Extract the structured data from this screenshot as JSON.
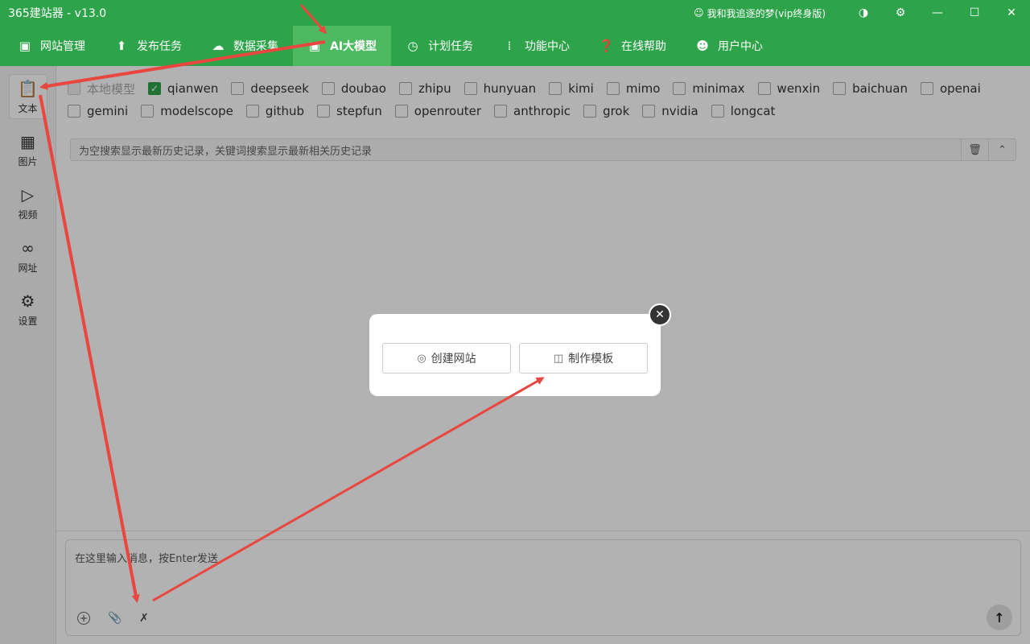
{
  "app": {
    "title": "365建站器 - v13.0",
    "user": "我和我追逐的梦(vip终身版)"
  },
  "menu": [
    {
      "label": "网站管理",
      "icon": "window-icon"
    },
    {
      "label": "发布任务",
      "icon": "upload-icon"
    },
    {
      "label": "数据采集",
      "icon": "cloud-download-icon"
    },
    {
      "label": "AI大模型",
      "icon": "robot-icon",
      "active": true
    },
    {
      "label": "计划任务",
      "icon": "clock-icon"
    },
    {
      "label": "功能中心",
      "icon": "grid-icon"
    },
    {
      "label": "在线帮助",
      "icon": "help-icon"
    },
    {
      "label": "用户中心",
      "icon": "user-icon"
    }
  ],
  "sidebar": [
    {
      "label": "文本",
      "icon": "clipboard-icon",
      "active": true
    },
    {
      "label": "图片",
      "icon": "image-icon"
    },
    {
      "label": "视频",
      "icon": "video-icon"
    },
    {
      "label": "网址",
      "icon": "link-icon"
    },
    {
      "label": "设置",
      "icon": "gear-icon"
    }
  ],
  "models": [
    {
      "label": "本地模型",
      "checked": false,
      "disabled": true
    },
    {
      "label": "qianwen",
      "checked": true
    },
    {
      "label": "deepseek",
      "checked": false
    },
    {
      "label": "doubao",
      "checked": false
    },
    {
      "label": "zhipu",
      "checked": false
    },
    {
      "label": "hunyuan",
      "checked": false
    },
    {
      "label": "kimi",
      "checked": false
    },
    {
      "label": "mimo",
      "checked": false
    },
    {
      "label": "minimax",
      "checked": false
    },
    {
      "label": "wenxin",
      "checked": false
    },
    {
      "label": "baichuan",
      "checked": false
    },
    {
      "label": "openai",
      "checked": false
    },
    {
      "label": "gemini",
      "checked": false
    },
    {
      "label": "modelscope",
      "checked": false
    },
    {
      "label": "github",
      "checked": false
    },
    {
      "label": "stepfun",
      "checked": false
    },
    {
      "label": "openrouter",
      "checked": false
    },
    {
      "label": "anthropic",
      "checked": false
    },
    {
      "label": "grok",
      "checked": false
    },
    {
      "label": "nvidia",
      "checked": false
    },
    {
      "label": "longcat",
      "checked": false
    }
  ],
  "search": {
    "placeholder": "为空搜索显示最新历史记录，关键词搜索显示最新相关历史记录"
  },
  "input": {
    "placeholder": "在这里输入消息，按Enter发送"
  },
  "modal": {
    "create_site": "创建网站",
    "make_template": "制作模板"
  },
  "colors": {
    "brand": "#2ea44a",
    "menu_active": "#4dba62",
    "annotation": "#e8463f"
  }
}
